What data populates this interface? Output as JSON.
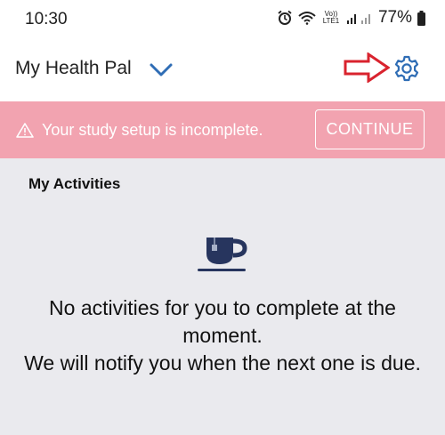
{
  "status_bar": {
    "time": "10:30",
    "network_label": "Vo)) LTE1",
    "battery_percent": "77%"
  },
  "header": {
    "title": "My Health Pal"
  },
  "banner": {
    "message": "Your study setup is incomplete.",
    "button_label": "CONTINUE"
  },
  "activities": {
    "section_title": "My Activities",
    "empty_line_1": "No activities for you to complete at the moment.",
    "empty_line_2": "We will notify you when the next one is due."
  },
  "colors": {
    "banner_bg": "#f2a3b0",
    "accent_blue": "#2f6db5",
    "annotation_red": "#d9232e",
    "content_bg": "#eaeaee",
    "cup_navy": "#27355e"
  },
  "icons": [
    "alarm-icon",
    "wifi-icon",
    "signal-icon",
    "battery-icon",
    "chevron-down-icon",
    "gear-icon",
    "arrow-right-icon",
    "warning-icon",
    "cup-icon"
  ]
}
